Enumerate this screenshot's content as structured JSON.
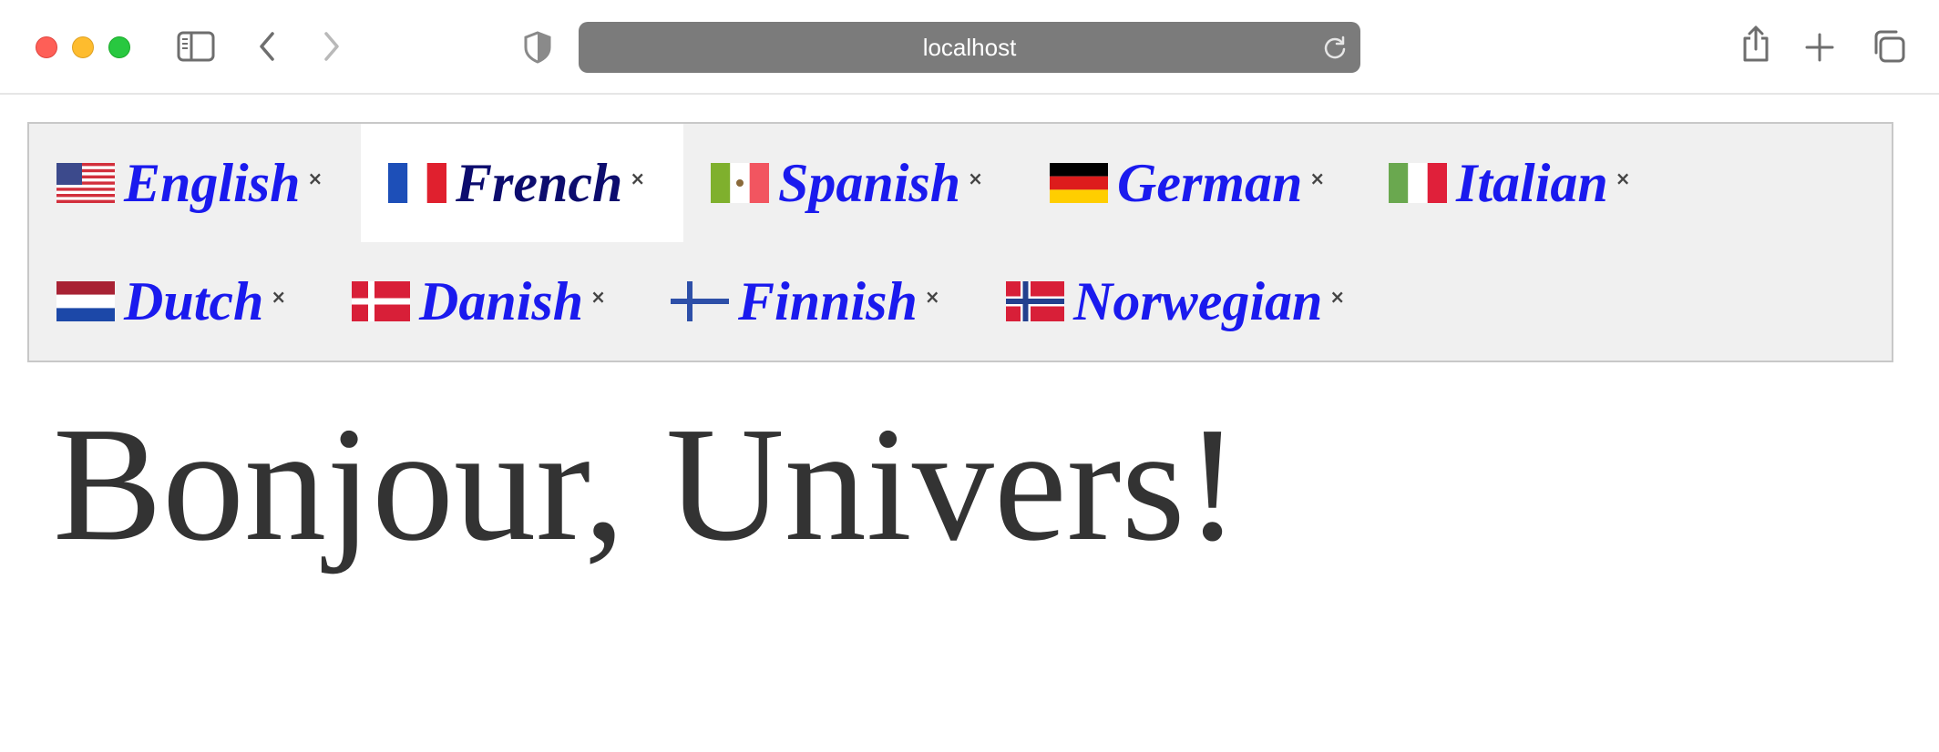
{
  "browser": {
    "url": "localhost",
    "icons": [
      "close-window",
      "minimize-window",
      "zoom-window",
      "sidebar-icon",
      "back-icon",
      "forward-icon",
      "shield-icon",
      "reload-icon",
      "share-icon",
      "new-tab-icon",
      "tab-overview-icon"
    ]
  },
  "tabs": [
    {
      "label": "English",
      "flag": "us-flag",
      "close": "×"
    },
    {
      "label": "French",
      "flag": "fr-flag",
      "close": "×",
      "active": true
    },
    {
      "label": "Spanish",
      "flag": "mx-flag",
      "close": "×"
    },
    {
      "label": "German",
      "flag": "de-flag",
      "close": "×"
    },
    {
      "label": "Italian",
      "flag": "it-flag",
      "close": "×"
    },
    {
      "label": "Dutch",
      "flag": "nl-flag",
      "close": "×"
    },
    {
      "label": "Danish",
      "flag": "dk-flag",
      "close": "×"
    },
    {
      "label": "Finnish",
      "flag": "fi-flag",
      "close": "×"
    },
    {
      "label": "Norwegian",
      "flag": "no-flag",
      "close": "×"
    }
  ],
  "content": {
    "greeting": "Bonjour, Univers!"
  },
  "colors": {
    "tab_text": "#1a1aee",
    "active_tab_text": "#0c0c6e",
    "greeting_text": "#333333"
  }
}
